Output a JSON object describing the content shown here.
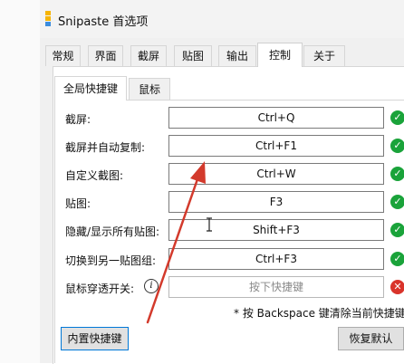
{
  "window": {
    "title": "Snipaste 首选项"
  },
  "tabs": [
    {
      "label": "常规"
    },
    {
      "label": "界面"
    },
    {
      "label": "截屏"
    },
    {
      "label": "贴图"
    },
    {
      "label": "输出"
    },
    {
      "label": "控制",
      "active": true
    },
    {
      "label": "关于"
    }
  ],
  "subtabs": [
    {
      "label": "全局快捷键",
      "active": true
    },
    {
      "label": "鼠标"
    }
  ],
  "shortcuts": [
    {
      "label": "截屏:",
      "value": "Ctrl+Q",
      "status": "ok"
    },
    {
      "label": "截屏并自动复制:",
      "value": "Ctrl+F1",
      "status": "ok"
    },
    {
      "label": "自定义截图:",
      "value": "Ctrl+W",
      "status": "ok"
    },
    {
      "label": "贴图:",
      "value": "F3",
      "status": "ok"
    },
    {
      "label": "隐藏/显示所有贴图:",
      "value": "Shift+F3",
      "status": "ok"
    },
    {
      "label": "切换到另一贴图组:",
      "value": "Ctrl+F3",
      "status": "ok"
    },
    {
      "label": "鼠标穿透开关:",
      "placeholder": "按下快捷键",
      "status": "error"
    }
  ],
  "hint": "* 按 Backspace 键清除当前快捷键",
  "buttons": {
    "builtin": "内置快捷键",
    "restore": "恢复默认"
  },
  "icons": {
    "ok": "check-circle-icon",
    "error": "x-circle-icon",
    "info": "info-icon"
  },
  "colors": {
    "ok": "#1aa33a",
    "error": "#d9342b",
    "arrow": "#d33a2c"
  }
}
